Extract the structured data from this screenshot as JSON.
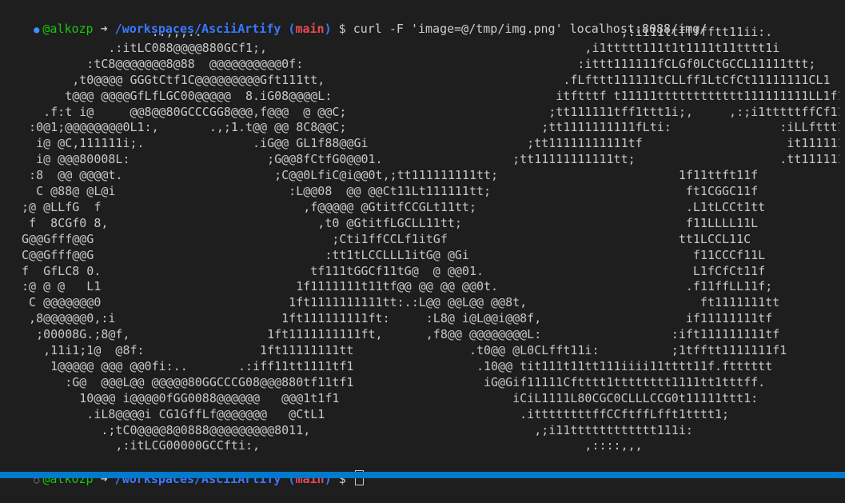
{
  "terminal": {
    "prompt": {
      "user": "@alkozp",
      "arrow": "➜",
      "path": "/workspaces/AsciiArtify",
      "branch_open": "(",
      "branch": "main",
      "branch_close": ")",
      "symbol": "$"
    },
    "command": "curl -F 'image=@/tmp/img.png' localhost:8088/img/",
    "output_lines": [
      "                   ..,,,..                                                          ,:ii11ttffffftt11ii:.",
      "             .:itLC088@@@@880GCf1;,                                            ,i1ttttt111t1t1111t11tttt1i",
      "          :tC8@@@@@@@8@88  @@@@@@@@@@0f:                                      :ittt111111fCLGf0LCtGCCL11111ttt;",
      "        ,t0@@@@ GGGtCtf1C@@@@@@@@@Gft111tt,                                 .fLfttt111111tCLLff1LtCfCt11111111CL1",
      "       t@@@ @@@@GfLfLGC00@@@@@  8.iG08@@@@L:                               itftttf t11111tttttttttttt111111111LL1f1",
      "    .f:t i@     @@8@@80GCCCGG8@@@,f@@@  @ @@C;                            ;tt111111tff1ttt1i;,     ,:;i1tttttffCf11tf;",
      "  :0@1;@@@@@@@@0L1:,       .,;1.t@@ @@ 8C8@@C;                           ;tt1111111111fLti:               :iLLfttt11111fi",
      "   i@ @C,111111i;.               .iG@@ GL1f88@@Gi                      ;tt11111111111tf                    it111111111fi",
      "   i@ @@@80008L:                   ;G@@8fCtfG0@@01.                  ;tt11111111111tt;                    .tt11111111L",
      "  :8  @@ @@@@t.                     ;C@@0LfiC@i@@0t,;tt111111111tt;                         1f11ttft11f",
      "   C @88@ @L@i                        :L@@08  @@ @@Ct11Lt111111tt;                           ft1CGGC11f",
      " ;@ @LLfG  f                            ,f@@@@@ @GtitfCCGLt11tt;                             .L1tLCCt1tt",
      "  f  8CGf0 8,                             ,t0 @GtitfLGCLL11tt;                               f11LLLL11L",
      " G@@Gfff@@G                                 ;Cti1ffCCLf1itGf                                tt1LCCL11C",
      " C@@Gfff@@G                                :tt1tLCCLLL1itG@ @Gi                               f11CCCf11L",
      " f  GfLC8 0.                             tf111tGGCf11tG@  @ @@01.                             L1fCfCt11f",
      " :@ @ @   L1                           1f1111111t11tf@@ @@ @@ @@0t.                          .f11ffLL11f;",
      "  C @@@@@@@0                          1ft1111111111tt:.:L@@ @@L@@ @@8t,                        ft1111111tt",
      "  ,8@@@@@@0,:i                       1ft111111111ft:     :L8@ i@L@@i@@8f,                    if11111111tf",
      "   ;00008G.;8@f,                   1ft1111111111ft,      ,f8@@ @@@@@@@@L:                  :ift111111111tf",
      "    ,11i1;1@  @8f:                1ft11111111tt                .t0@@ @L0CLfft11i:          ;1tfftt1111111f1",
      "     1@@@@@ @@@ @@0fi:..       .:iff11tt1111tf1                 .10@@ tit111t11tt111iiii11tttt11f.ftttttt",
      "       :G@  @@@L@@ @@@@@80GGCCCG08@@@880tf11tf1                  iG@Gif11111Cftttt1tttttttt1111tt1tttff.",
      "         10@@@ i@@@@0fGG0088@@@@@@   @@@1t1f1                        iCiL1111L80CGC0CLLLCCG0t11111ttt1:",
      "          .iL8@@@@i CG1GffLf@@@@@@@   @CtL1                           .ittttttttffCCftffLfft1tttt1;",
      "            .;tC0@@@@8@0888@@@@@@@@@8011,                               ,;i11tttttttttttt111i:",
      "              ,:itLCG00000GCCfti:,                                             ,::::,,,"
    ],
    "final_prompt_note": ""
  },
  "colors": {
    "background": "#1e1e1e",
    "user": "#16c60c",
    "path": "#3b78ff",
    "branch": "#e74856",
    "text": "#cccccc",
    "statusbar": "#007acc"
  }
}
